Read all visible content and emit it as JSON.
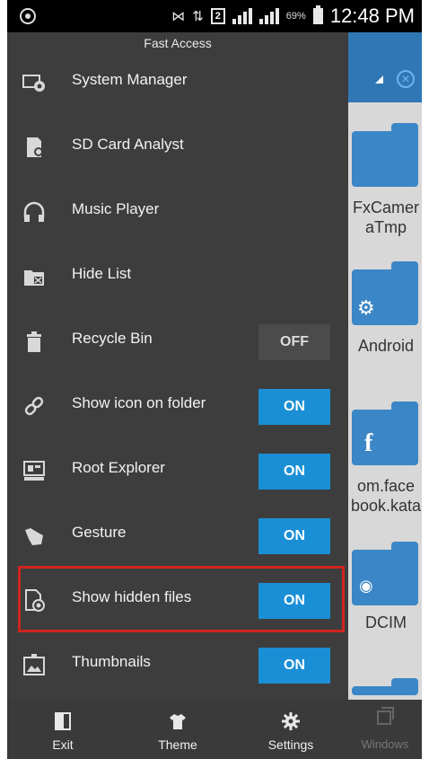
{
  "status_bar": {
    "time": "12:48 PM",
    "battery": "69%",
    "sim": "2"
  },
  "drawer": {
    "title": "Fast Access",
    "items": [
      {
        "label": "System Manager"
      },
      {
        "label": "SD Card Analyst"
      },
      {
        "label": "Music Player"
      },
      {
        "label": "Hide List"
      },
      {
        "label": "Recycle Bin",
        "toggle": "OFF"
      },
      {
        "label": "Show icon on folder",
        "toggle": "ON"
      },
      {
        "label": "Root Explorer",
        "toggle": "ON"
      },
      {
        "label": "Gesture",
        "toggle": "ON"
      },
      {
        "label": "Show hidden files",
        "toggle": "ON"
      },
      {
        "label": "Thumbnails",
        "toggle": "ON"
      }
    ],
    "bottom": {
      "exit": "Exit",
      "theme": "Theme",
      "settings": "Settings"
    }
  },
  "background": {
    "folders": [
      {
        "label_line1": "FxCamer",
        "label_line2": "aTmp"
      },
      {
        "label_line1": "Android"
      },
      {
        "label_line1": "om.face",
        "label_line2": "book.kata"
      },
      {
        "label_line1": "DCIM"
      }
    ],
    "windows_label": "Windows"
  },
  "colors": {
    "accent": "#1a8fd6",
    "highlight": "#d0241f",
    "drawer_bg": "#3d3d3d"
  }
}
